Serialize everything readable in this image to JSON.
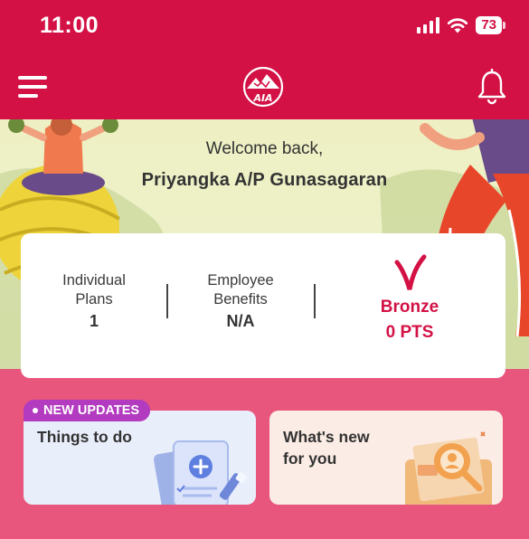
{
  "status_bar": {
    "time": "11:00",
    "battery": "73"
  },
  "header": {
    "logo_text": "AIA"
  },
  "hero": {
    "welcome": "Welcome back,",
    "user_name": "Priyangka A/P Gunasagaran"
  },
  "summary": {
    "individual_plans": {
      "label_line1": "Individual",
      "label_line2": "Plans",
      "value": "1"
    },
    "employee_benefits": {
      "label_line1": "Employee",
      "label_line2": "Benefits",
      "value": "N/A"
    },
    "vitality": {
      "tier": "Bronze",
      "points": "0 PTS"
    }
  },
  "cards": {
    "todo": {
      "badge": "NEW UPDATES",
      "title": "Things to do"
    },
    "whats_new": {
      "title_line1": "What's new",
      "title_line2": "for you"
    }
  },
  "colors": {
    "brand": "#d31145",
    "badge": "#b23bbf",
    "lower_bg": "#e8557d"
  }
}
